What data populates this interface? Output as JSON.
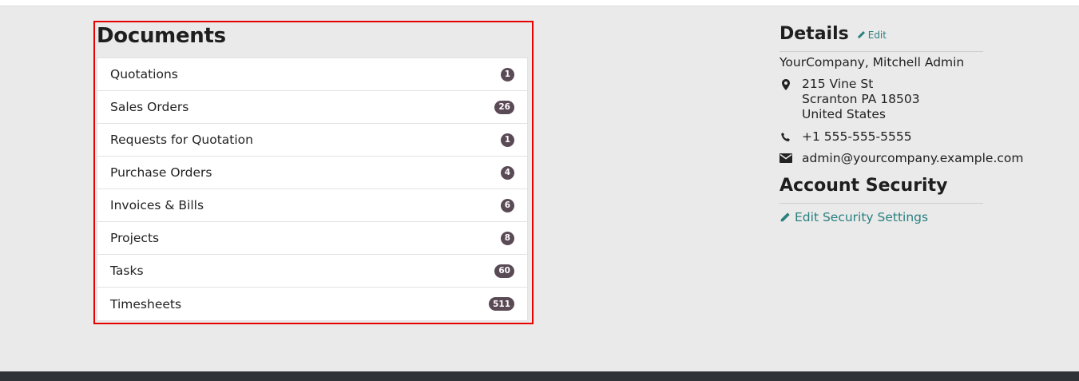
{
  "documents": {
    "title": "Documents",
    "items": [
      {
        "label": "Quotations",
        "count": "1"
      },
      {
        "label": "Sales Orders",
        "count": "26"
      },
      {
        "label": "Requests for Quotation",
        "count": "1"
      },
      {
        "label": "Purchase Orders",
        "count": "4"
      },
      {
        "label": "Invoices & Bills",
        "count": "6"
      },
      {
        "label": "Projects",
        "count": "8"
      },
      {
        "label": "Tasks",
        "count": "60"
      },
      {
        "label": "Timesheets",
        "count": "511"
      }
    ]
  },
  "details": {
    "title": "Details",
    "edit_label": "Edit",
    "company": "YourCompany, Mitchell Admin",
    "address": [
      "215 Vine St",
      "Scranton PA 18503",
      "United States"
    ],
    "phone": "+1 555-555-5555",
    "email": "admin@yourcompany.example.com"
  },
  "security": {
    "title": "Account Security",
    "link_label": "Edit Security Settings"
  },
  "colors": {
    "accent": "#2a7f7f",
    "badge": "#5a4a55",
    "highlight": "#e60000"
  },
  "icons": [
    "pencil-icon",
    "map-marker-icon",
    "phone-icon",
    "envelope-icon"
  ]
}
